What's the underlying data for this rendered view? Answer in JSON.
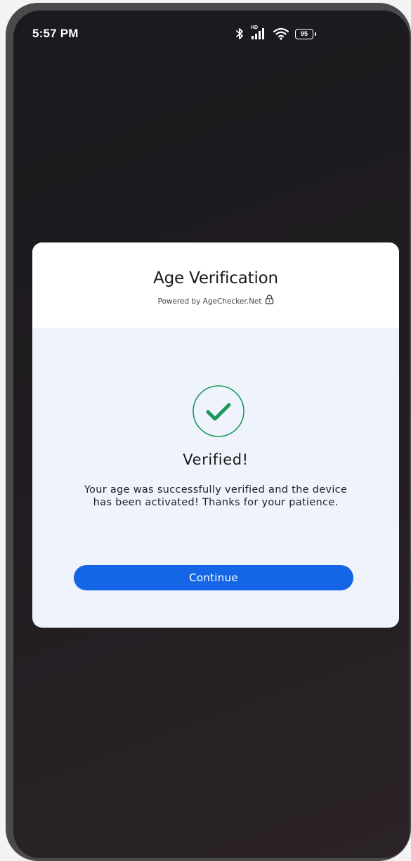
{
  "status_bar": {
    "time": "5:57 PM",
    "hd_label": "HD",
    "battery_level": "95",
    "icons": [
      "bluetooth-icon",
      "signal-icon",
      "wifi-icon",
      "battery-icon"
    ]
  },
  "modal": {
    "title": "Age Verification",
    "powered_by": "Powered by AgeChecker.Net",
    "powered_icon": "lock-icon",
    "status_icon": "check-circle-icon",
    "verified_title": "Verified!",
    "message": "Your age was successfully verified and the device has been activated! Thanks for your patience.",
    "continue_label": "Continue"
  },
  "colors": {
    "accent": "#1466e6",
    "success": "#1a9a5b",
    "modal_body_bg": "#eff3fb"
  }
}
